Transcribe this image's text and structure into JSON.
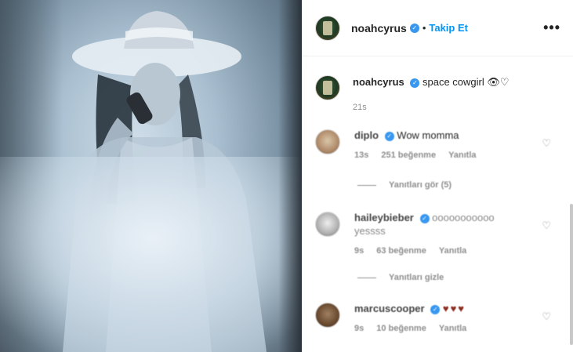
{
  "post": {
    "author": "noahcyrus",
    "follow_label": "Takip Et",
    "separator": "•",
    "more_label": "•••",
    "caption_text": "space cowgirl",
    "caption_emoji": "👁♡",
    "time": "21s"
  },
  "comments": [
    {
      "username": "diplo",
      "text": "Wow momma",
      "time": "13s",
      "likes": "251 beğenme",
      "reply": "Yanıtla",
      "replies_label": "Yanıtları gör (5)"
    },
    {
      "username": "haileybieber",
      "text": "ooooooooooo",
      "text2": "yessss",
      "time": "9s",
      "likes": "63 beğenme",
      "reply": "Yanıtla",
      "replies_label": "Yanıtları gizle"
    },
    {
      "username": "marcuscooper",
      "text": "♥♥♥",
      "time": "9s",
      "likes": "10 beğenme",
      "reply": "Yanıtla"
    }
  ],
  "icons": {
    "verified": "verified-badge-icon",
    "heart": "heart-icon",
    "more": "more-options-icon"
  },
  "colors": {
    "follow": "#0095f6",
    "verified": "#3897f0",
    "muted": "#8e8e8e"
  }
}
